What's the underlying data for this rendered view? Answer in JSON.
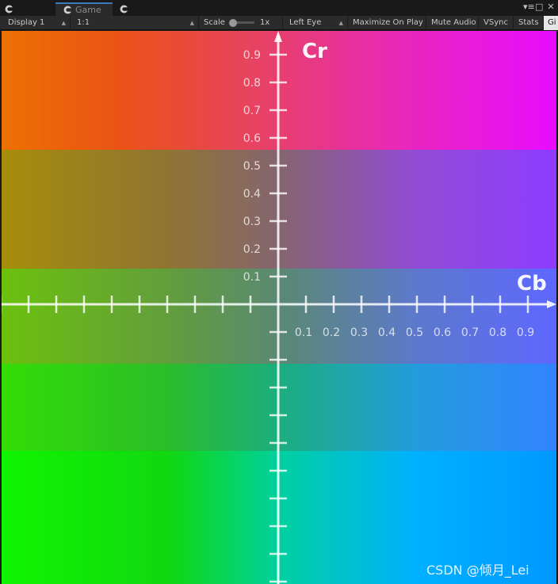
{
  "tabs": {
    "game_label": "Game"
  },
  "toolbar": {
    "display": "Display 1",
    "aspect": "1:1",
    "scale_label": "Scale",
    "scale_value": "1x",
    "eye": "Left Eye",
    "maximize": "Maximize On Play",
    "mute": "Mute Audio",
    "vsync": "VSync",
    "stats": "Stats",
    "gizmos": "Gi"
  },
  "plane": {
    "y_axis_label": "Cr",
    "x_axis_label": "Cb",
    "y_ticks": [
      "0.9",
      "0.8",
      "0.7",
      "0.6",
      "0.5",
      "0.4",
      "0.3",
      "0.2",
      "0.1"
    ],
    "x_ticks": [
      "0.1",
      "0.2",
      "0.3",
      "0.4",
      "0.5",
      "0.6",
      "0.7",
      "0.8",
      "0.9"
    ],
    "colors": {
      "top_left": "#ff5a00",
      "top_right": "#ff00ff",
      "bottom_left": "#00ff00",
      "bottom_right": "#0090ff",
      "center": "#6a7a6a",
      "axis": "#ffffff"
    }
  },
  "watermark": "CSDN @倾月_Lei"
}
